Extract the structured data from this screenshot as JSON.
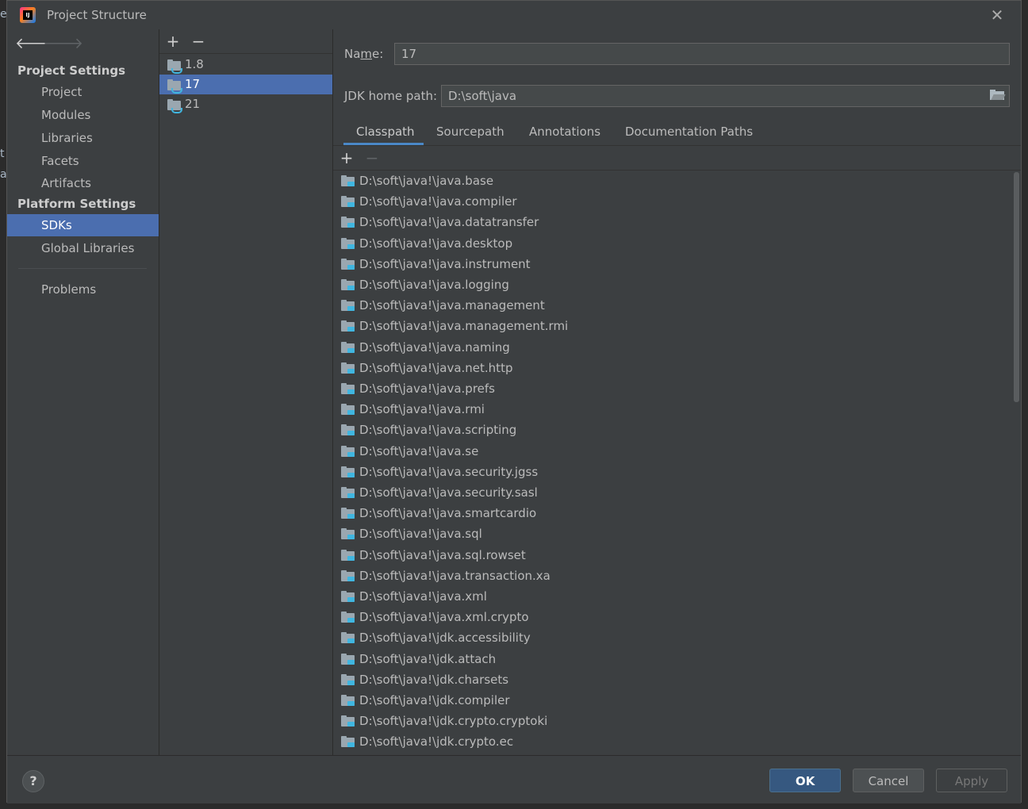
{
  "window": {
    "title": "Project Structure"
  },
  "sidebar": {
    "project_settings_header": "Project Settings",
    "project_items": [
      "Project",
      "Modules",
      "Libraries",
      "Facets",
      "Artifacts"
    ],
    "platform_settings_header": "Platform Settings",
    "platform_items": [
      "SDKs",
      "Global Libraries"
    ],
    "problems": "Problems",
    "selected": "SDKs"
  },
  "sdk_list": {
    "items": [
      "1.8",
      "17",
      "21"
    ],
    "selected": "17"
  },
  "detail": {
    "name_label": "Name:",
    "name_value": "17",
    "jdk_home_label": "JDK home path:",
    "jdk_home_value": "D:\\soft\\java",
    "tabs": [
      "Classpath",
      "Sourcepath",
      "Annotations",
      "Documentation Paths"
    ],
    "active_tab": "Classpath",
    "classpath": [
      "D:\\soft\\java!\\java.base",
      "D:\\soft\\java!\\java.compiler",
      "D:\\soft\\java!\\java.datatransfer",
      "D:\\soft\\java!\\java.desktop",
      "D:\\soft\\java!\\java.instrument",
      "D:\\soft\\java!\\java.logging",
      "D:\\soft\\java!\\java.management",
      "D:\\soft\\java!\\java.management.rmi",
      "D:\\soft\\java!\\java.naming",
      "D:\\soft\\java!\\java.net.http",
      "D:\\soft\\java!\\java.prefs",
      "D:\\soft\\java!\\java.rmi",
      "D:\\soft\\java!\\java.scripting",
      "D:\\soft\\java!\\java.se",
      "D:\\soft\\java!\\java.security.jgss",
      "D:\\soft\\java!\\java.security.sasl",
      "D:\\soft\\java!\\java.smartcardio",
      "D:\\soft\\java!\\java.sql",
      "D:\\soft\\java!\\java.sql.rowset",
      "D:\\soft\\java!\\java.transaction.xa",
      "D:\\soft\\java!\\java.xml",
      "D:\\soft\\java!\\java.xml.crypto",
      "D:\\soft\\java!\\jdk.accessibility",
      "D:\\soft\\java!\\jdk.attach",
      "D:\\soft\\java!\\jdk.charsets",
      "D:\\soft\\java!\\jdk.compiler",
      "D:\\soft\\java!\\jdk.crypto.cryptoki",
      "D:\\soft\\java!\\jdk.crypto.ec"
    ]
  },
  "footer": {
    "help": "?",
    "ok": "OK",
    "cancel": "Cancel",
    "apply": "Apply"
  },
  "colors": {
    "selection": "#4b6eaf",
    "dialog_bg": "#3c3f41",
    "tab_underline": "#4a88c7",
    "primary_button": "#365880",
    "jdk_badge": "#40b6e0"
  }
}
